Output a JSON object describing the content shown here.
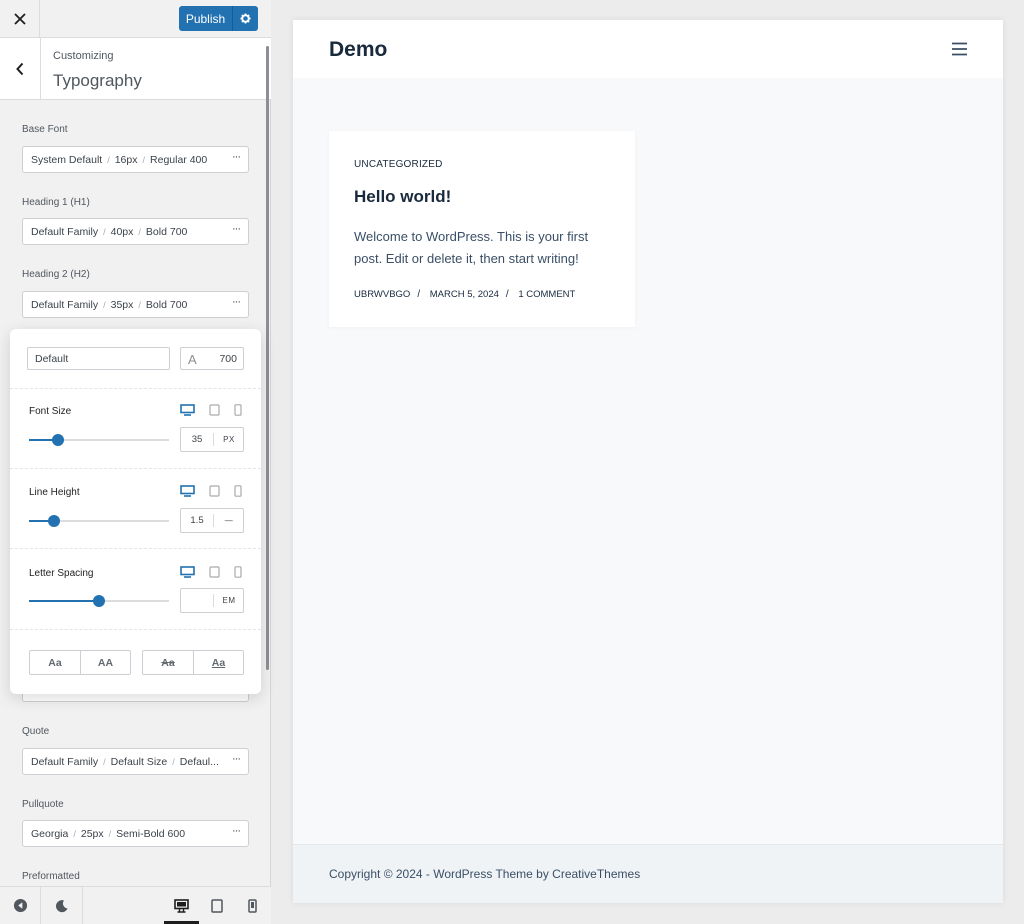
{
  "topbar": {
    "close_icon": "close-icon",
    "publish_label": "Publish",
    "publish_settings_icon": "gear-icon"
  },
  "section": {
    "back_icon": "chevron-left-icon",
    "customizing": "Customizing",
    "title": "Typography"
  },
  "options": [
    {
      "label": "Base Font",
      "family": "System Default",
      "size": "16px",
      "weight": "Regular 400"
    },
    {
      "label": "Heading 1 (H1)",
      "family": "Default Family",
      "size": "40px",
      "weight": "Bold 700"
    },
    {
      "label": "Heading 2 (H2)",
      "family": "Default Family",
      "size": "35px",
      "weight": "Bold 700"
    },
    {
      "label": "Quote",
      "family": "Default Family",
      "size": "Default Size",
      "weight": "Defaul..."
    },
    {
      "label": "Pullquote",
      "family": "Georgia",
      "size": "25px",
      "weight": "Semi-Bold 600"
    },
    {
      "label": "Preformatted"
    }
  ],
  "popover": {
    "family": "Default",
    "weight_glyph": "A",
    "weight_value": "700",
    "controls": [
      {
        "label": "Font Size",
        "value": "35",
        "unit": "PX",
        "slider_fraction": 0.21
      },
      {
        "label": "Line Height",
        "value": "1.5",
        "unit": "—",
        "slider_fraction": 0.18
      },
      {
        "label": "Letter Spacing",
        "value": "",
        "unit": "EM",
        "slider_fraction": 0.5
      }
    ],
    "active_device": "desktop",
    "case_buttons": [
      "Aa",
      "AA"
    ],
    "decoration_buttons": [
      "Aa",
      "Aa"
    ]
  },
  "footer": {
    "icons": [
      "collapse-icon",
      "moon-icon",
      "desktop-icon",
      "tablet-icon",
      "mobile-icon"
    ],
    "active": "desktop"
  },
  "preview": {
    "site_title": "Demo",
    "menu_icon": "hamburger-menu-icon",
    "post": {
      "category": "UNCATEGORIZED",
      "title": "Hello world!",
      "excerpt": "Welcome to WordPress. This is your first post. Edit or delete it, then start writing!",
      "author": "UBRWVBGO",
      "date": "MARCH 5, 2024",
      "comments": "1 COMMENT"
    },
    "copyright": "Copyright © 2024 - WordPress Theme by CreativeThemes"
  },
  "colors": {
    "accent": "#2271b1",
    "heading": "#192a3d",
    "text": "#3a4f66",
    "preview_bg": "#f7f9fb"
  }
}
